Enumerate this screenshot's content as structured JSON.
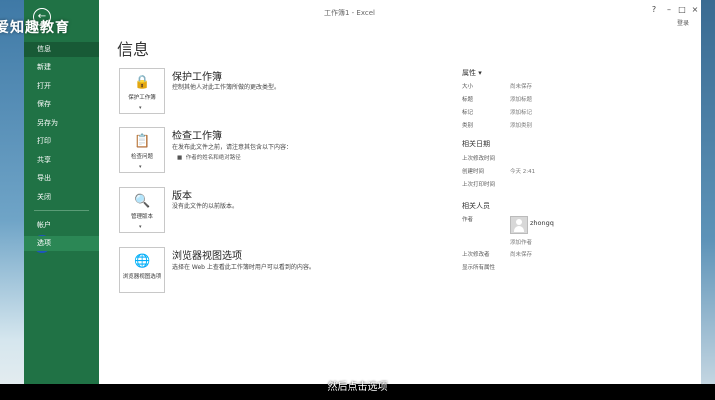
{
  "window": {
    "title": "工作簿1 - Excel",
    "help": "?",
    "minimize": "–",
    "restore": "□",
    "close": "×",
    "signin": "登录"
  },
  "logo": "爱知趣教育",
  "sidebar": {
    "back_icon": "←",
    "items": [
      {
        "label": "信息"
      },
      {
        "label": "新建"
      },
      {
        "label": "打开"
      },
      {
        "label": "保存"
      },
      {
        "label": "另存为"
      },
      {
        "label": "打印"
      },
      {
        "label": "共享"
      },
      {
        "label": "导出"
      },
      {
        "label": "关闭"
      },
      {
        "label": "帐户"
      },
      {
        "label": "选项"
      }
    ]
  },
  "page": {
    "title": "信息"
  },
  "sections": {
    "protect": {
      "button_label": "保护工作簿",
      "title": "保护工作簿",
      "desc": "控制其他人对此工作簿所做的更改类型。"
    },
    "inspect": {
      "button_label": "检查问题",
      "title": "检查工作簿",
      "desc": "在发布此文件之前，请注意其包含以下内容：",
      "bullet": "作者的姓名和绝对路径"
    },
    "versions": {
      "button_label": "管理版本",
      "title": "版本",
      "desc": "没有此文件的以前版本。"
    },
    "browser": {
      "button_label": "浏览器视图选项",
      "title": "浏览器视图选项",
      "desc": "选择在 Web 上查看此工作簿时用户可以看到的内容。"
    }
  },
  "properties": {
    "header": "属性 ▾",
    "rows": [
      {
        "key": "大小",
        "value": "尚未保存"
      },
      {
        "key": "标题",
        "value": "添加标题"
      },
      {
        "key": "标记",
        "value": "添加标记"
      },
      {
        "key": "类别",
        "value": "添加类别"
      }
    ],
    "dates_header": "相关日期",
    "dates": [
      {
        "key": "上次修改时间",
        "value": ""
      },
      {
        "key": "创建时间",
        "value": "今天 2:41"
      },
      {
        "key": "上次打印时间",
        "value": ""
      }
    ],
    "people_header": "相关人员",
    "author_key": "作者",
    "author_name": "zhongq",
    "add_author": "添加作者",
    "last_modified_by_key": "上次修改者",
    "last_modified_by_value": "尚未保存",
    "show_all": "显示所有属性"
  },
  "subtitle": "然后点击选项"
}
